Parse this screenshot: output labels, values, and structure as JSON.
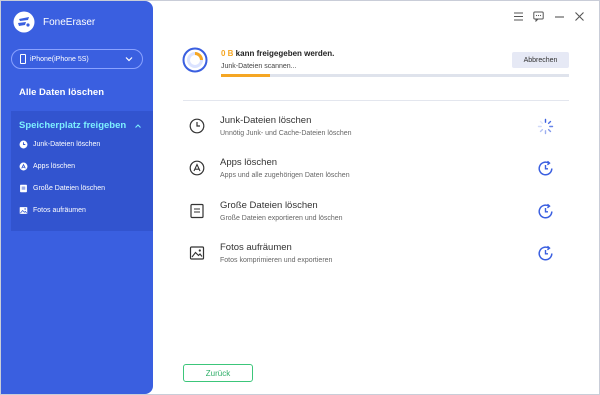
{
  "app": {
    "title": "FoneEraser"
  },
  "device": {
    "selected": "iPhone(iPhone 5S)"
  },
  "sidebar": {
    "main_item": "Alle Daten löschen",
    "group": {
      "title": "Speicherplatz freigeben",
      "items": [
        {
          "label": "Junk-Dateien löschen",
          "icon": "clock-icon"
        },
        {
          "label": "Apps löschen",
          "icon": "app-store-icon"
        },
        {
          "label": "Große Dateien löschen",
          "icon": "file-icon"
        },
        {
          "label": "Fotos aufräumen",
          "icon": "photo-icon"
        }
      ]
    }
  },
  "scan": {
    "amount": "0 B",
    "title_suffix": " kann freigegeben werden.",
    "status": "Junk-Dateien scannen...",
    "progress_fraction": 0.14,
    "abort_label": "Abbrechen"
  },
  "tasks": [
    {
      "title": "Junk-Dateien löschen",
      "desc": "Unnötig Junk- und Cache-Dateien löschen",
      "icon": "clock-icon",
      "status": "loading"
    },
    {
      "title": "Apps löschen",
      "desc": "Apps und alle zugehörigen Daten löschen",
      "icon": "app-store-icon",
      "status": "pending"
    },
    {
      "title": "Große Dateien löschen",
      "desc": "Große Dateien exportieren und löschen",
      "icon": "file-icon",
      "status": "pending"
    },
    {
      "title": "Fotos aufräumen",
      "desc": "Fotos komprimieren und exportieren",
      "icon": "photo-icon",
      "status": "pending"
    }
  ],
  "footer": {
    "back_label": "Zurück"
  },
  "colors": {
    "accent": "#3a5fe0",
    "highlight": "#7df0ff",
    "progress": "#f5a623",
    "back": "#2fae68"
  }
}
